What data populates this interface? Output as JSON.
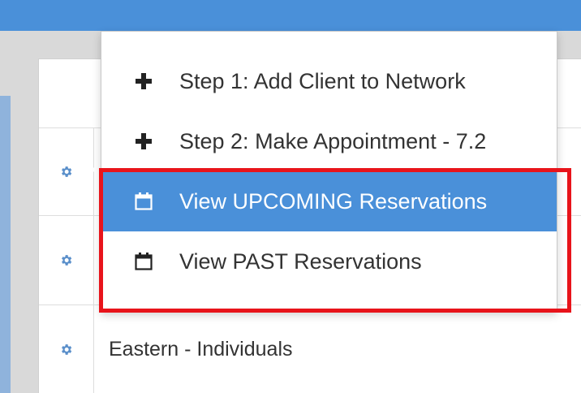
{
  "table": {
    "rows": [
      {
        "text": ""
      },
      {
        "text": ""
      },
      {
        "text": ""
      },
      {
        "text": "Eastern - Individuals"
      }
    ]
  },
  "menu": {
    "items": [
      {
        "label": "Step 1: Add Client to Network",
        "icon": "plus-icon"
      },
      {
        "label": "Step 2: Make Appointment - 7.2",
        "icon": "plus-icon"
      },
      {
        "label": "View UPCOMING Reservations",
        "icon": "calendar-icon",
        "active": true
      },
      {
        "label": "View PAST Reservations",
        "icon": "calendar-icon"
      }
    ]
  },
  "colors": {
    "accent": "#4a90d9",
    "highlight": "#e8141b",
    "gear": "#5a8fca"
  }
}
